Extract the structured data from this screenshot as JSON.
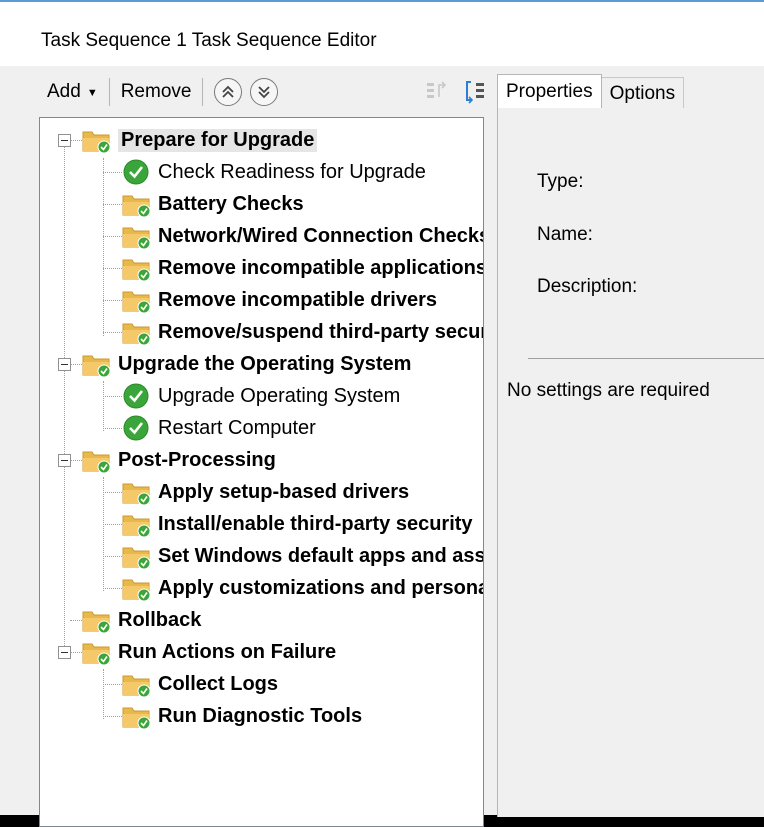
{
  "window": {
    "title": "Task Sequence 1 Task Sequence Editor"
  },
  "toolbar": {
    "add_label": "Add",
    "remove_label": "Remove",
    "move_up_icon": "double-chevron-up-icon",
    "move_down_icon": "double-chevron-down-icon"
  },
  "tree": {
    "items": [
      {
        "label": "Prepare for Upgrade",
        "type": "group"
      },
      {
        "label": "Check Readiness for Upgrade",
        "type": "step-check"
      },
      {
        "label": "Battery Checks",
        "type": "group"
      },
      {
        "label": "Network/Wired Connection Checks",
        "type": "group"
      },
      {
        "label": "Remove incompatible applications",
        "type": "group"
      },
      {
        "label": "Remove incompatible drivers",
        "type": "group"
      },
      {
        "label": "Remove/suspend third-party security",
        "type": "group"
      },
      {
        "label": "Upgrade the Operating System",
        "type": "group"
      },
      {
        "label": "Upgrade Operating System",
        "type": "step-check"
      },
      {
        "label": "Restart Computer",
        "type": "step-check"
      },
      {
        "label": "Post-Processing",
        "type": "group"
      },
      {
        "label": "Apply setup-based drivers",
        "type": "group"
      },
      {
        "label": "Install/enable third-party security",
        "type": "group"
      },
      {
        "label": "Set Windows default apps and associations",
        "type": "group"
      },
      {
        "label": "Apply customizations and personalization",
        "type": "group"
      },
      {
        "label": "Rollback",
        "type": "group"
      },
      {
        "label": "Run Actions on Failure",
        "type": "group"
      },
      {
        "label": "Collect Logs",
        "type": "group"
      },
      {
        "label": "Run Diagnostic Tools",
        "type": "group"
      }
    ]
  },
  "tabs": [
    {
      "label": "Properties",
      "active": true
    },
    {
      "label": "Options",
      "active": false
    }
  ],
  "properties": {
    "type_label": "Type:",
    "name_label": "Name:",
    "description_label": "Description:",
    "settings_note": "No settings are required"
  },
  "colors": {
    "folder_yellow": "#f5c96a",
    "check_green": "#3aa639",
    "title_border": "#5a9bd5"
  }
}
